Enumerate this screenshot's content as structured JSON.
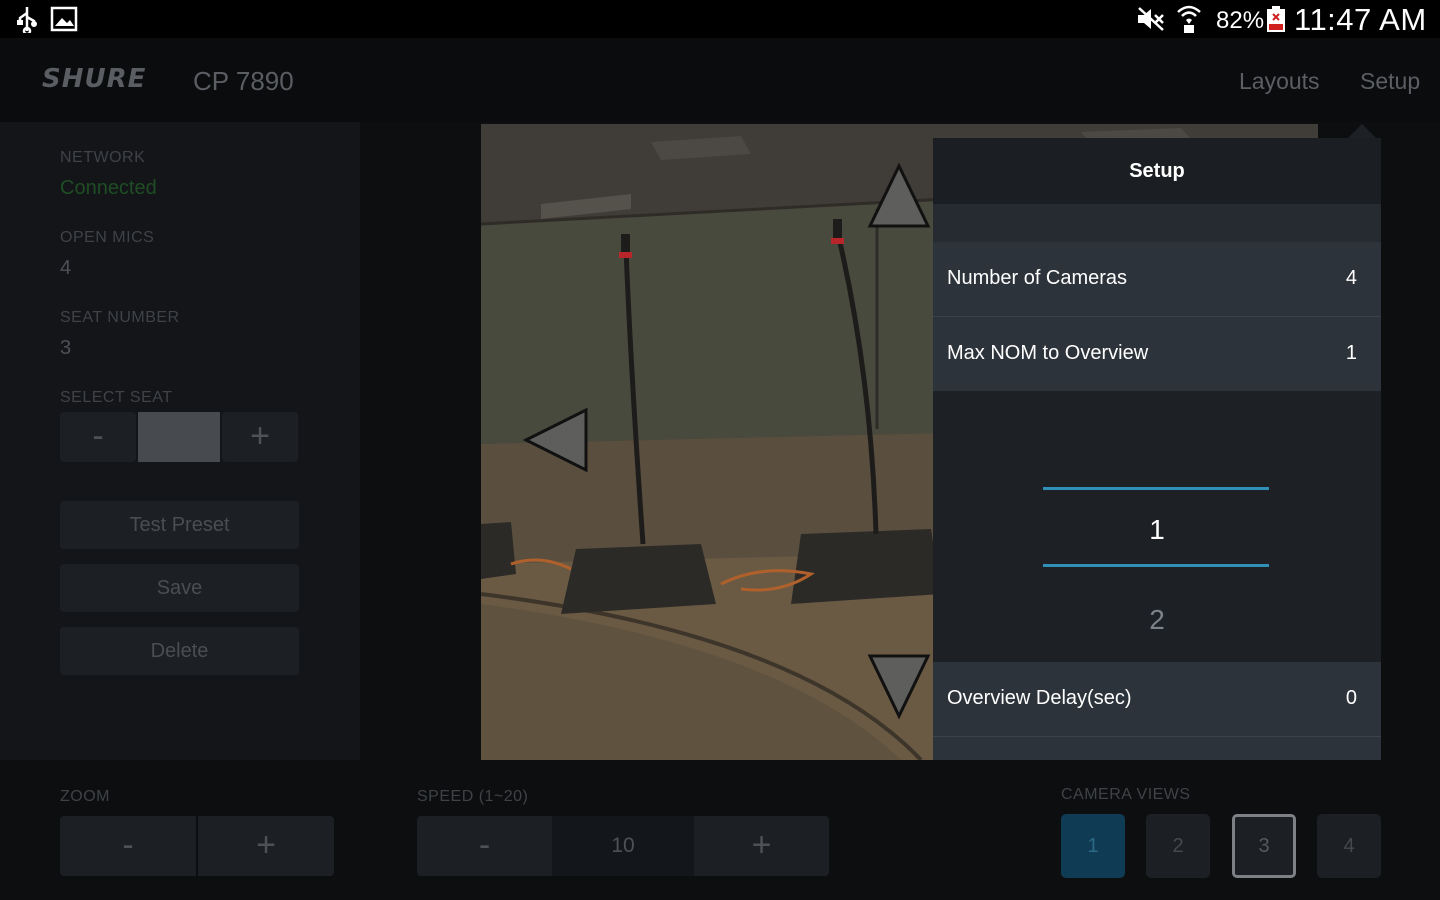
{
  "status_bar": {
    "icons": [
      "usb-icon",
      "gallery-icon",
      "mute-icon",
      "wifi-icon",
      "battery-icon"
    ],
    "battery_percent": "82%",
    "time": "11:47 AM"
  },
  "header": {
    "brand": "SHURE",
    "model": "CP 7890",
    "nav": {
      "layouts": "Layouts",
      "setup": "Setup"
    }
  },
  "left_panel": {
    "network_label": "NETWORK",
    "network_value": "Connected",
    "open_mics_label": "OPEN MICS",
    "open_mics_value": "4",
    "seat_number_label": "SEAT NUMBER",
    "seat_number_value": "3",
    "select_seat_label": "SELECT SEAT",
    "select_seat_minus": "-",
    "select_seat_plus": "+",
    "buttons": {
      "test_preset": "Test Preset",
      "save": "Save",
      "delete": "Delete"
    }
  },
  "setup_popover": {
    "title": "Setup",
    "rows": [
      {
        "label": "Number of Cameras",
        "value": "4"
      },
      {
        "label": "Max NOM to Overview",
        "value": "1"
      },
      {
        "label": "Overview Delay(sec)",
        "value": "0"
      }
    ],
    "picker": {
      "selected": "1",
      "next": "2"
    }
  },
  "bottom": {
    "zoom_label": "ZOOM",
    "zoom_minus": "-",
    "zoom_plus": "+",
    "speed_label": "SPEED (1~20)",
    "speed_minus": "-",
    "speed_value": "10",
    "speed_plus": "+",
    "camera_views_label": "CAMERA VIEWS",
    "camera_views": [
      "1",
      "2",
      "3",
      "4"
    ],
    "active_view": "1",
    "focused_view": "3"
  },
  "colors": {
    "accent_blue": "#2f8fb7",
    "connected_green": "#1f4d24",
    "active_view_bg": "#0f3b55"
  }
}
